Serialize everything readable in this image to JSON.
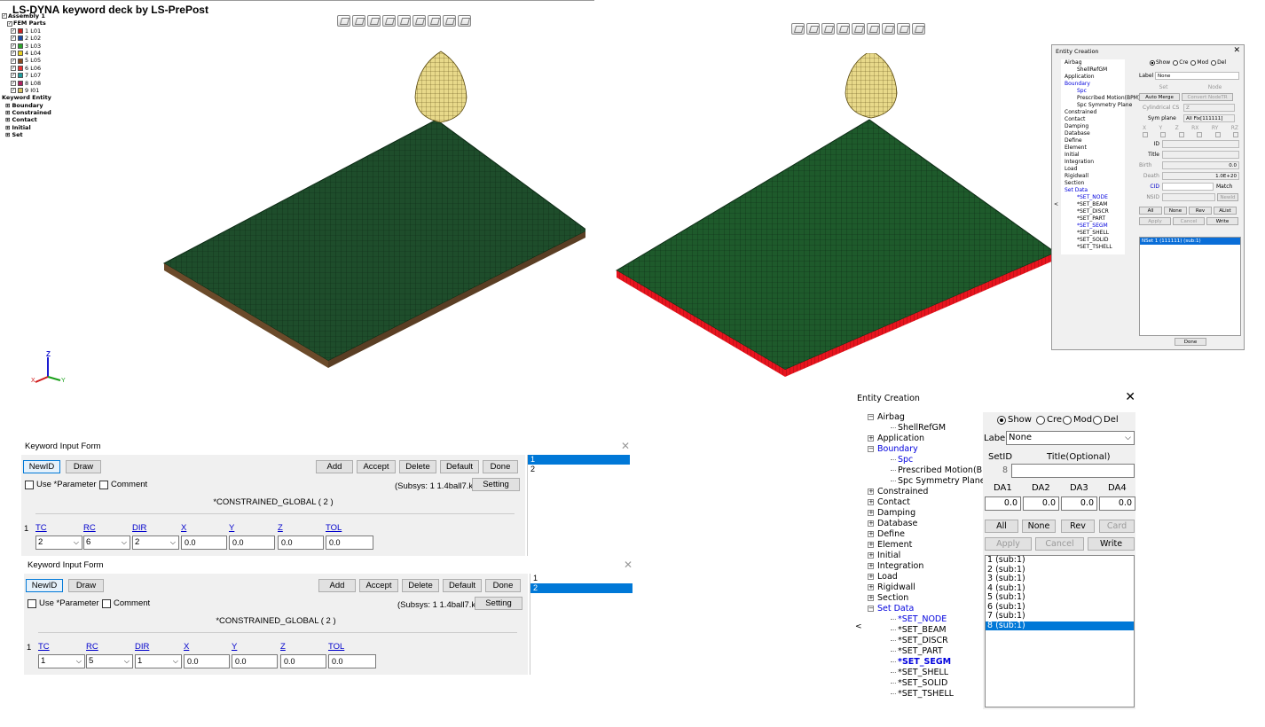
{
  "viewport1": {
    "title": "LS-DYNA keyword deck by LS-PrePost",
    "tree": {
      "assembly": "Assembly 1",
      "fem_parts": "FEM Parts",
      "parts": [
        {
          "label": "1 L01",
          "color": "#cc2020"
        },
        {
          "label": "2 L02",
          "color": "#1a4aa8"
        },
        {
          "label": "3 L03",
          "color": "#2aa82a"
        },
        {
          "label": "4 L04",
          "color": "#e8d020"
        },
        {
          "label": "5 L05",
          "color": "#8a4a20"
        },
        {
          "label": "6 L06",
          "color": "#e83030"
        },
        {
          "label": "7 L07",
          "color": "#20a0a0"
        },
        {
          "label": "8 L08",
          "color": "#b02060"
        },
        {
          "label": "9 I01",
          "color": "#d8c060"
        }
      ],
      "keyword_entity": "Keyword Entity",
      "keywords": [
        "Boundary",
        "Constrained",
        "Contact",
        "Initial",
        "Set"
      ]
    },
    "axis": {
      "x": "X",
      "y": "Y",
      "z": "Z"
    }
  },
  "colors": {
    "plate": "#1e4d2b",
    "plate_edge": "#6b4a2a",
    "spc_red": "#e8141e",
    "ball": "#e8d98a",
    "selection": "#0078d7"
  },
  "ent_small": {
    "title": "Entity Creation",
    "tree": [
      "Airbag",
      "ShellRefGM",
      "Application",
      "Boundary",
      "Spc",
      "Prescribed Motion(BPM)",
      "Spc Symmetry Plane",
      "Constrained",
      "Contact",
      "Damping",
      "Database",
      "Define",
      "Element",
      "Initial",
      "Integration",
      "Load",
      "Rigidwall",
      "Section",
      "Set Data",
      "*SET_NODE",
      "*SET_BEAM",
      "*SET_DISCR",
      "*SET_PART",
      "*SET_SEGM",
      "*SET_SHELL",
      "*SET_SOLID",
      "*SET_TSHELL"
    ],
    "radios": [
      "Show",
      "Cre",
      "Mod",
      "Del"
    ],
    "label_lbl": "Label",
    "label_val": "None",
    "set_lbl": "Set",
    "node_lbl": "Node",
    "auto_merge": "Auto Merge",
    "convert": "Convert NodeTR",
    "cyl": "Cylindrical CS",
    "cyl_val": "Z",
    "sym": "Sym plane",
    "sym_val": "All Fix[111111]",
    "dofs": [
      "X",
      "Y",
      "Z",
      "RX",
      "RY",
      "RZ"
    ],
    "id_lbl": "ID",
    "title_lbl": "Title",
    "birth_lbl": "Birth",
    "birth_val": "0.0",
    "death_lbl": "Death",
    "death_val": "1.0E+20",
    "cid_lbl": "CID",
    "match_lbl": "Match",
    "nsid_lbl": "NSID",
    "newid": "NewId",
    "btns": [
      "All",
      "None",
      "Rev",
      "AList"
    ],
    "apply": "Apply",
    "cancel": "Cancel",
    "write": "Write",
    "list_item": "NSet 1 (111111) (sub:1)",
    "done": "Done"
  },
  "form1": {
    "title": "Keyword Input Form",
    "newid": "NewID",
    "draw": "Draw",
    "add": "Add",
    "accept": "Accept",
    "delete": "Delete",
    "default": "Default",
    "done": "Done",
    "use_param": "Use *Parameter",
    "comment": "Comment",
    "subsys": "(Subsys: 1 1.4ball7.k)",
    "setting": "Setting",
    "keyword": "*CONSTRAINED_GLOBAL   ( 2 )",
    "row": "1",
    "fields": [
      "TC",
      "RC",
      "DIR",
      "X",
      "Y",
      "Z",
      "TOL"
    ],
    "tc": "2",
    "rc": "6",
    "dir": "2",
    "x": "0.0",
    "y": "0.0",
    "z": "0.0",
    "tol": "0.0",
    "list": [
      "1",
      "2"
    ]
  },
  "form2": {
    "title": "Keyword Input Form",
    "newid": "NewID",
    "draw": "Draw",
    "add": "Add",
    "accept": "Accept",
    "delete": "Delete",
    "default": "Default",
    "done": "Done",
    "use_param": "Use *Parameter",
    "comment": "Comment",
    "subsys": "(Subsys: 1 1.4ball7.k)",
    "setting": "Setting",
    "keyword": "*CONSTRAINED_GLOBAL   ( 2 )",
    "row": "1",
    "fields": [
      "TC",
      "RC",
      "DIR",
      "X",
      "Y",
      "Z",
      "TOL"
    ],
    "tc": "1",
    "rc": "5",
    "dir": "1",
    "x": "0.0",
    "y": "0.0",
    "z": "0.0",
    "tol": "0.0",
    "list": [
      "1",
      "2"
    ]
  },
  "ent": {
    "title": "Entity Creation",
    "tree": [
      {
        "t": "Airbag",
        "pm": "−",
        "lvl": 0
      },
      {
        "t": "ShellRefGM",
        "lvl": 1
      },
      {
        "t": "Application",
        "pm": "+",
        "lvl": 0
      },
      {
        "t": "Boundary",
        "pm": "−",
        "lvl": 0,
        "blue": true
      },
      {
        "t": "Spc",
        "lvl": 1,
        "blue": true
      },
      {
        "t": "Prescribed Motion(BPM)",
        "lvl": 1
      },
      {
        "t": "Spc Symmetry Plane",
        "lvl": 1
      },
      {
        "t": "Constrained",
        "pm": "+",
        "lvl": 0
      },
      {
        "t": "Contact",
        "pm": "+",
        "lvl": 0
      },
      {
        "t": "Damping",
        "pm": "+",
        "lvl": 0
      },
      {
        "t": "Database",
        "pm": "+",
        "lvl": 0
      },
      {
        "t": "Define",
        "pm": "+",
        "lvl": 0
      },
      {
        "t": "Element",
        "pm": "+",
        "lvl": 0
      },
      {
        "t": "Initial",
        "pm": "+",
        "lvl": 0
      },
      {
        "t": "Integration",
        "pm": "+",
        "lvl": 0
      },
      {
        "t": "Load",
        "pm": "+",
        "lvl": 0
      },
      {
        "t": "Rigidwall",
        "pm": "+",
        "lvl": 0
      },
      {
        "t": "Section",
        "pm": "+",
        "lvl": 0
      },
      {
        "t": "Set Data",
        "pm": "−",
        "lvl": 0,
        "blue": true
      },
      {
        "t": "*SET_NODE",
        "lvl": 1,
        "blue": true
      },
      {
        "t": "*SET_BEAM",
        "lvl": 1
      },
      {
        "t": "*SET_DISCR",
        "lvl": 1
      },
      {
        "t": "*SET_PART",
        "lvl": 1
      },
      {
        "t": "*SET_SEGM",
        "lvl": 1,
        "blue": true,
        "bold": true
      },
      {
        "t": "*SET_SHELL",
        "lvl": 1
      },
      {
        "t": "*SET_SOLID",
        "lvl": 1
      },
      {
        "t": "*SET_TSHELL",
        "lvl": 1
      }
    ],
    "radios": [
      "Show",
      "Cre",
      "Mod",
      "Del"
    ],
    "label_lbl": "Label:",
    "label_val": "None",
    "setid_lbl": "SetID",
    "setid_val": "8",
    "title_lbl": "Title(Optional)",
    "da": [
      "DA1",
      "DA2",
      "DA3",
      "DA4"
    ],
    "da_vals": [
      "0.0",
      "0.0",
      "0.0",
      "0.0"
    ],
    "all": "All",
    "none": "None",
    "rev": "Rev",
    "card": "Card",
    "apply": "Apply",
    "cancel": "Cancel",
    "write": "Write",
    "list": [
      "1 (sub:1)",
      "2 (sub:1)",
      "3 (sub:1)",
      "4 (sub:1)",
      "5 (sub:1)",
      "6 (sub:1)",
      "7 (sub:1)",
      "8 (sub:1)"
    ],
    "left_arrow": "<"
  }
}
